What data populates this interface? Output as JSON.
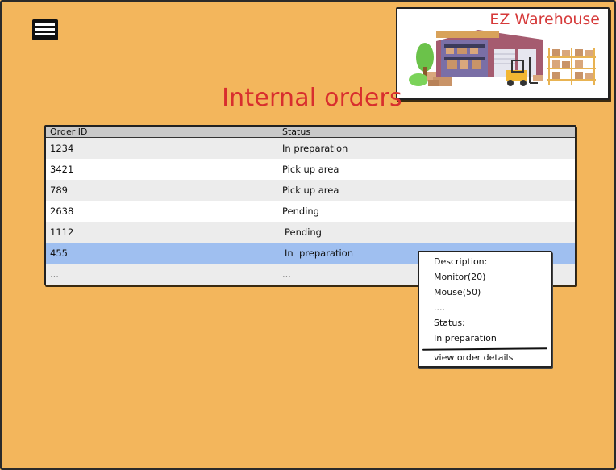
{
  "app": {
    "title": "EZ Warehouse",
    "menu_icon": "hamburger-menu-icon",
    "colors": {
      "background": "#f3b65c",
      "title_red": "#d82e2e",
      "selected_row": "#9fbff0",
      "header_row": "#c9c9c9"
    }
  },
  "page": {
    "title": "Internal orders"
  },
  "table": {
    "columns": [
      "Order ID",
      "Status"
    ],
    "rows": [
      {
        "id": "1234",
        "status": "In preparation"
      },
      {
        "id": "3421",
        "status": "Pick up area"
      },
      {
        "id": "789",
        "status": "Pick up area"
      },
      {
        "id": "2638",
        "status": "Pending"
      },
      {
        "id": "1112",
        "status": "Pending"
      },
      {
        "id": "455",
        "status": "In  preparation",
        "selected": true
      },
      {
        "id": "...",
        "status": "..."
      }
    ]
  },
  "popup": {
    "description_label": "Description:",
    "items": [
      "Monitor(20)",
      "Mouse(50)",
      "...."
    ],
    "status_label": "Status:",
    "status_value": "In preparation",
    "link": "view order details"
  }
}
